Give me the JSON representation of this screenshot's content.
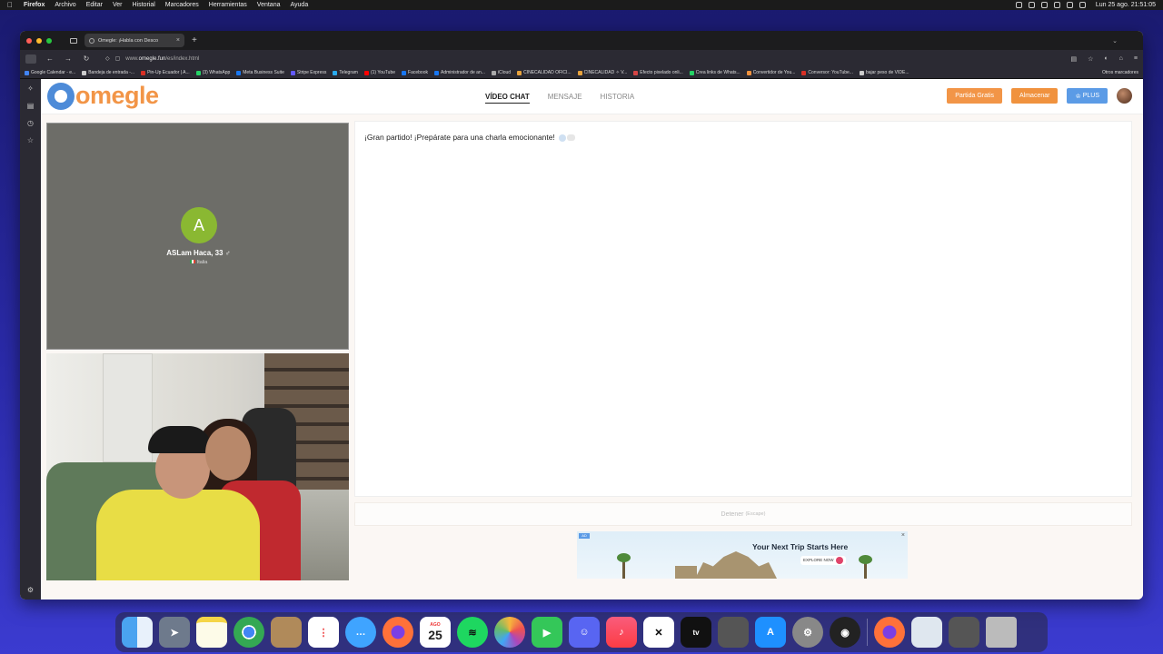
{
  "menubar": {
    "app": "Firefox",
    "items": [
      "Archivo",
      "Editar",
      "Ver",
      "Historial",
      "Marcadores",
      "Herramientas",
      "Ventana",
      "Ayuda"
    ],
    "clock": "Lun 25 ago.  21:51:05"
  },
  "browser": {
    "tab_title": "Omegle: ¡Habla con Desco",
    "url_prefix": "www.",
    "url_domain": "omegle.fun",
    "url_path": "/es/index.html",
    "bookmarks": [
      {
        "label": "Google Calendar - e...",
        "color": "#4285f4"
      },
      {
        "label": "Bandeja de entrada -...",
        "color": "#cccccc"
      },
      {
        "label": "Pin-Up Ecuador | A...",
        "color": "#d93025"
      },
      {
        "label": "(3) WhatsApp",
        "color": "#25d366"
      },
      {
        "label": "Meta Business Suite",
        "color": "#1877f2"
      },
      {
        "label": "Stripe Express",
        "color": "#635bff"
      },
      {
        "label": "Telegram",
        "color": "#2aabee"
      },
      {
        "label": "(1) YouTube",
        "color": "#ff0000"
      },
      {
        "label": "Facebook",
        "color": "#1877f2"
      },
      {
        "label": "Administrador de an...",
        "color": "#1877f2"
      },
      {
        "label": "iCloud",
        "color": "#aaaaaa"
      },
      {
        "label": "CINECALIDAD OFICI...",
        "color": "#e8a33d"
      },
      {
        "label": "CINECALIDAD ✧ V...",
        "color": "#e8a33d"
      },
      {
        "label": "Efecto pixelado onli...",
        "color": "#d64545"
      },
      {
        "label": "Crea links de Whats...",
        "color": "#25d366"
      },
      {
        "label": "Convertidor de You...",
        "color": "#f0923e"
      },
      {
        "label": "Conversor: YouTube...",
        "color": "#d93025"
      },
      {
        "label": "bajar peso de VIDE...",
        "color": "#cccccc"
      }
    ],
    "other_bookmarks": "Otros marcadores"
  },
  "site": {
    "logo_text": "omegle",
    "nav": [
      "VÍDEO CHAT",
      "MENSAJE",
      "HISTORIA"
    ],
    "buttons": {
      "free_match": "Partida Gratis",
      "store": "Almacenar",
      "plus": "PLUS"
    },
    "stranger": {
      "initial": "A",
      "name": "ASLam Haca, 33 ♂",
      "country": "Italia"
    },
    "chat": {
      "message": "¡Gran partido! ¡Prepárate para una charla emocionante!"
    },
    "stop": {
      "label": "Detener",
      "hint": "(Escape)"
    },
    "ad": {
      "badge": "AD",
      "headline": "Your Next Trip Starts Here",
      "cta": "EXPLORE NOW"
    }
  },
  "dock": {
    "calendar_day": "25",
    "calendar_month": "AGO"
  },
  "colors": {
    "accent_orange": "#f29547",
    "plus_blue": "#5b9be6",
    "stranger_avatar": "#8ab832"
  }
}
